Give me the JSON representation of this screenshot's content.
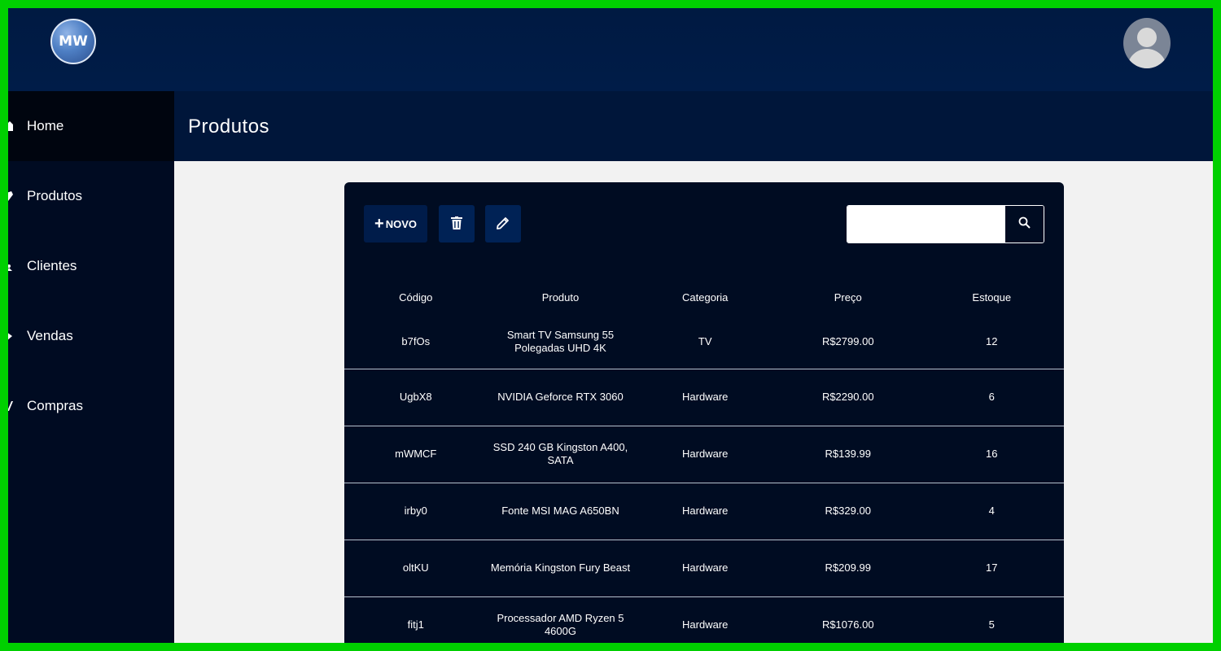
{
  "app": {
    "logo_text": "MW",
    "avatar": "user-avatar-icon"
  },
  "sidebar": {
    "items": [
      {
        "label": "Home",
        "icon": "home-icon",
        "active": true
      },
      {
        "label": "Produtos",
        "icon": "box-icon",
        "active": false
      },
      {
        "label": "Clientes",
        "icon": "users-icon",
        "active": false
      },
      {
        "label": "Vendas",
        "icon": "sales-icon",
        "active": false
      },
      {
        "label": "Compras",
        "icon": "cart-icon",
        "active": false
      }
    ]
  },
  "header": {
    "title": "Produtos"
  },
  "toolbar": {
    "new_label": "NOVO",
    "new_icon": "plus-icon",
    "delete_icon": "trash-icon",
    "edit_icon": "pencil-icon",
    "search_value": "",
    "search_icon": "search-icon"
  },
  "table": {
    "headers": [
      "Código",
      "Produto",
      "Categoria",
      "Preço",
      "Estoque"
    ],
    "rows": [
      [
        "b7fOs",
        "Smart TV Samsung 55 Polegadas UHD 4K",
        "TV",
        "R$2799.00",
        "12"
      ],
      [
        "UgbX8",
        "NVIDIA Geforce RTX 3060",
        "Hardware",
        "R$2290.00",
        "6"
      ],
      [
        "mWMCF",
        "SSD 240 GB Kingston A400, SATA",
        "Hardware",
        "R$139.99",
        "16"
      ],
      [
        "irby0",
        "Fonte MSI MAG A650BN",
        "Hardware",
        "R$329.00",
        "4"
      ],
      [
        "oltKU",
        "Memória Kingston Fury Beast",
        "Hardware",
        "R$209.99",
        "17"
      ],
      [
        "fitj1",
        "Processador AMD Ryzen 5 4600G",
        "Hardware",
        "R$1076.00",
        "5"
      ]
    ]
  },
  "colors": {
    "topbar": "#001a42",
    "sidebar": "#000b22",
    "panel": "#000c22",
    "button": "#002255",
    "content_bg": "#f2f2f2",
    "frame": "#00d000"
  }
}
